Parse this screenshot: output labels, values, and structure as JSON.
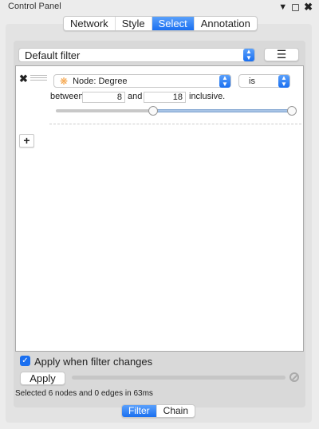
{
  "panel": {
    "title": "Control Panel"
  },
  "tabs": [
    {
      "label": "Network"
    },
    {
      "label": "Style"
    },
    {
      "label": "Select",
      "active": true
    },
    {
      "label": "Annotation"
    }
  ],
  "filter_select": {
    "value": "Default filter"
  },
  "condition": {
    "attribute": "Node: Degree",
    "operator": "is",
    "between_label": "between",
    "min": "8",
    "and_label": "and",
    "max": "18",
    "inclusive_label": "inclusive.",
    "range_low_fraction": 0.4,
    "range_high_fraction": 1.0
  },
  "add_button": "+",
  "apply_checkbox": {
    "label": "Apply when filter changes",
    "checked": true
  },
  "apply_button": "Apply",
  "status": "Selected 6 nodes and 0 edges in 63ms",
  "bottom_tabs": [
    {
      "label": "Filter",
      "active": true
    },
    {
      "label": "Chain"
    }
  ],
  "colors": {
    "accent": "#1a6ff0",
    "node_icon": "#f5a040"
  }
}
